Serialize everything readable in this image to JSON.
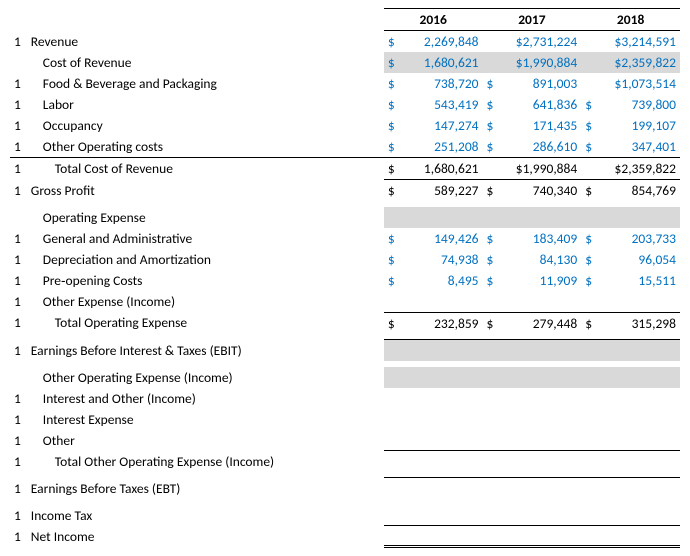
{
  "headers": {
    "y1": "2016",
    "y2": "2017",
    "y3": "2018"
  },
  "mark": "1",
  "sym": "$",
  "rows": {
    "revenue": {
      "label": "Revenue",
      "v1": "2,269,848",
      "v2": "$2,731,224",
      "v3": "$3,214,591"
    },
    "cost_of_revenue_hdr": {
      "label": "Cost of Revenue",
      "v1": "1,680,621",
      "v2": "$1,990,884",
      "v3": "$2,359,822"
    },
    "food_bev": {
      "label": "Food & Beverage and Packaging",
      "v1": "738,720",
      "v2": "891,003",
      "v3": "$1,073,514"
    },
    "labor": {
      "label": "Labor",
      "v1": "543,419",
      "v2": "641,836",
      "v3": "739,800"
    },
    "occupancy": {
      "label": "Occupancy",
      "v1": "147,274",
      "v2": "171,435",
      "v3": "199,107"
    },
    "other_op_costs": {
      "label": "Other Operating costs",
      "v1": "251,208",
      "v2": "286,610",
      "v3": "347,401"
    },
    "total_cor": {
      "label": "Total Cost of Revenue",
      "v1": "1,680,621",
      "v2": "$1,990,884",
      "v3": "$2,359,822"
    },
    "gross_profit": {
      "label": "Gross Profit",
      "v1": "589,227",
      "v2": "740,340",
      "v3": "854,769"
    },
    "opex_hdr": {
      "label": "Operating Expense"
    },
    "ga": {
      "label": "General and Administrative",
      "v1": "149,426",
      "v2": "183,409",
      "v3": "203,733"
    },
    "da": {
      "label": "Depreciation and Amortization",
      "v1": "74,938",
      "v2": "84,130",
      "v3": "96,054"
    },
    "preopen": {
      "label": "Pre‑opening Costs",
      "v1": "8,495",
      "v2": "11,909",
      "v3": "15,511"
    },
    "other_exp_inc": {
      "label": "Other Expense (Income)"
    },
    "total_opex": {
      "label": "Total Operating Expense",
      "v1": "232,859",
      "v2": "279,448",
      "v3": "315,298"
    },
    "ebit": {
      "label": "Earnings Before Interest & Taxes (EBIT)"
    },
    "other_op_exp_hdr": {
      "label": "Other Operating Expense (Income)"
    },
    "interest_other_inc": {
      "label": "Interest and Other (Income)"
    },
    "interest_exp": {
      "label": "Interest Expense"
    },
    "other": {
      "label": "Other"
    },
    "total_other_opex": {
      "label": "Total Other Operating Expense (Income)"
    },
    "ebt": {
      "label": "Earnings Before Taxes (EBT)"
    },
    "income_tax": {
      "label": "Income Tax"
    },
    "net_income": {
      "label": "Net Income"
    }
  }
}
